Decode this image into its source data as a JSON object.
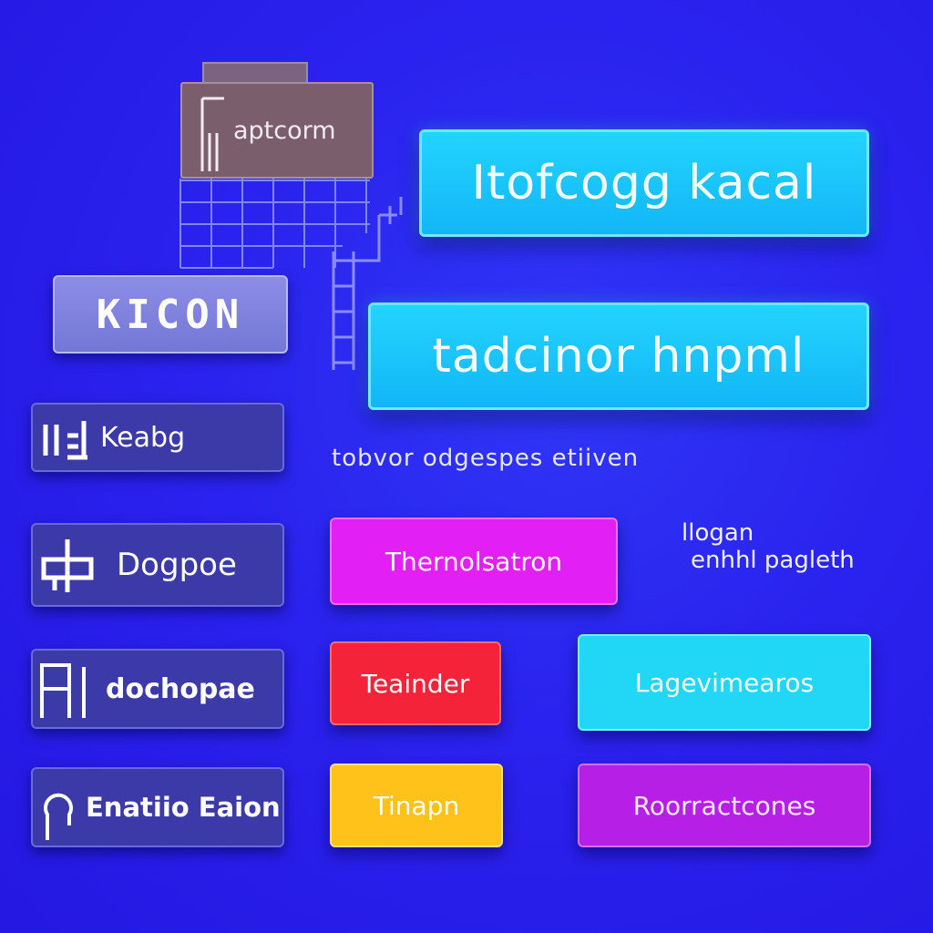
{
  "app_tile": {
    "label": "aptcorm"
  },
  "headlines": [
    {
      "label": "Itofcogg kacal"
    },
    {
      "label": "tadcinor hnpml"
    }
  ],
  "left_stack": {
    "icon_tile": {
      "label": "KICON"
    },
    "items": [
      {
        "label": "Keabg",
        "icon": "bars-icon"
      },
      {
        "label": "Dogpoe",
        "icon": "cross-connector-icon"
      },
      {
        "label": "dochopae",
        "icon": "bracket-icon"
      },
      {
        "label": "Enatiio Eaion",
        "icon": "loop-icon"
      }
    ]
  },
  "caption": "tobvor odgespes etiiven",
  "side_note": {
    "line1": "llogan",
    "line2": "enhhl pagleth"
  },
  "buttons": {
    "magenta": "Thernolsatron",
    "red": "Teainder",
    "yellow": "Tinapn",
    "cyan": "Lagevimearos",
    "purple": "Roorractcones"
  },
  "colors": {
    "background": "#2a1ff0",
    "cyan": "#12b6f6",
    "magenta": "#e21ff4",
    "red": "#f4233a",
    "yellow": "#ffc21a",
    "purple": "#b51fe6",
    "navy": "#3b3aa8",
    "brown": "#7b5e6c"
  }
}
